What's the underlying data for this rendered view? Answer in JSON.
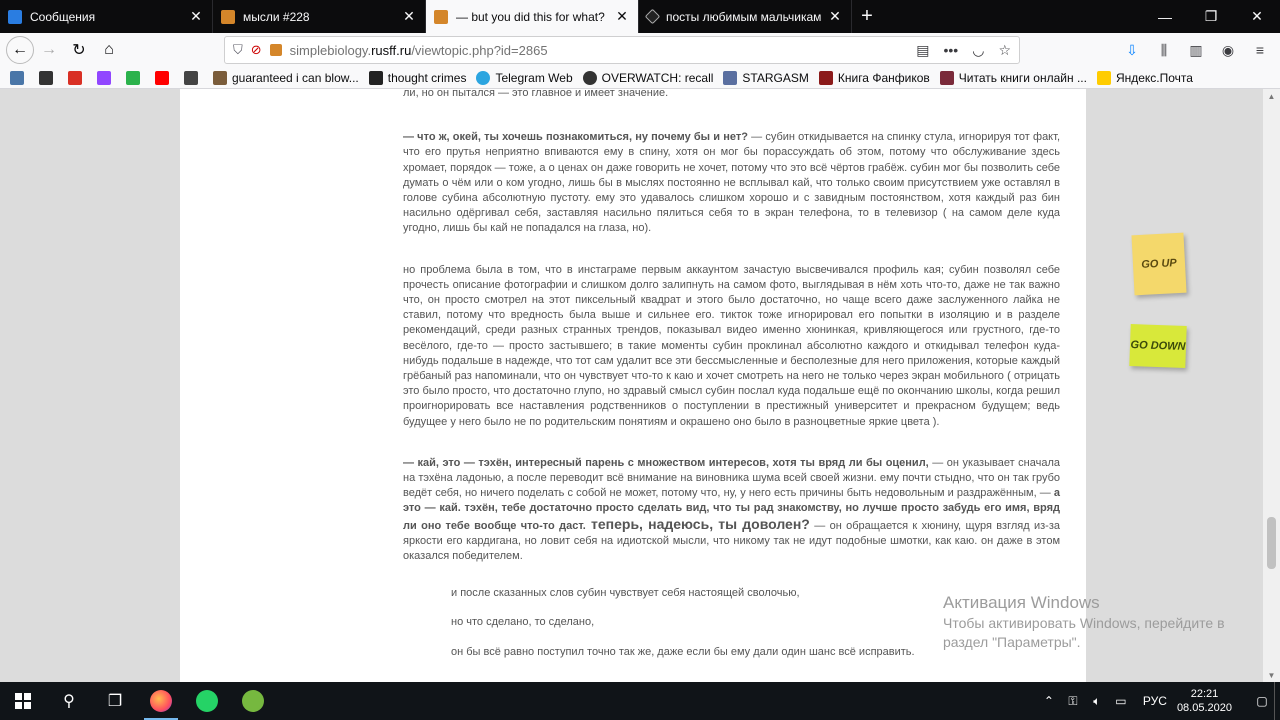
{
  "tabs": [
    {
      "title": "Сообщения",
      "favicon_color": "#2a7de1",
      "active": false
    },
    {
      "title": "мысли #228",
      "favicon_color": "#d4862a",
      "active": false
    },
    {
      "title": "— but you did this for what?",
      "favicon_color": "#d4862a",
      "active": true
    },
    {
      "title": "посты любимым мальчикам",
      "favicon_color": "#222222",
      "active": false
    }
  ],
  "navbar": {
    "url_prefix": "simplebiology.",
    "url_host": "rusff.ru",
    "url_path": "/viewtopic.php?id=2865"
  },
  "bookmarks": [
    {
      "label": "",
      "icon": "vk-icon",
      "color": "#4a76a8"
    },
    {
      "label": "",
      "icon": "bookmark-icon",
      "color": "#333333"
    },
    {
      "label": "",
      "icon": "gmail-icon",
      "color": "#d93025"
    },
    {
      "label": "",
      "icon": "twitch-icon",
      "color": "#9146ff"
    },
    {
      "label": "",
      "icon": "feedly-icon",
      "color": "#2bb24c"
    },
    {
      "label": "",
      "icon": "youtube-icon",
      "color": "#ff0000"
    },
    {
      "label": "",
      "icon": "photoshop-icon",
      "color": "#444444"
    },
    {
      "label": "guaranteed i can blow...",
      "icon": "image-icon",
      "color": "#7a5c3a"
    },
    {
      "label": "thought crimes",
      "icon": "image-icon",
      "color": "#222222"
    },
    {
      "label": "Telegram Web",
      "icon": "telegram-icon",
      "color": "#2ca5e0"
    },
    {
      "label": "OVERWATCH: recall",
      "icon": "overwatch-icon",
      "color": "#333333"
    },
    {
      "label": "STARGASM",
      "icon": "image-icon",
      "color": "#5a6fa0"
    },
    {
      "label": "Книга Фанфиков",
      "icon": "feather-icon",
      "color": "#8b1a1a"
    },
    {
      "label": "Читать книги онлайн ...",
      "icon": "book-icon",
      "color": "#7a2a3a"
    },
    {
      "label": "Яндекс.Почта",
      "icon": "mail-icon",
      "color": "#ffcc00"
    }
  ],
  "post": {
    "top_partial": "ли, но он пытался — это главное и имеет значение.",
    "p1_bold": "— что ж, окей, ты хочешь познакомиться, ну почему бы и нет?",
    "p1_text": " — субин откидывается на спинку стула, игнорируя тот факт, что его прутья неприятно впиваются ему в спину, хотя он мог бы порассуждать об этом, потому что обслуживание здесь хромает, порядок — тоже, а о ценах он даже говорить не хочет, потому что это всё чёртов грабёж. субин мог бы позволить себе думать о чём или о ком угодно, лишь бы в мыслях постоянно не всплывал кай, что только своим присутствием уже оставлял в голове субина абсолютную пустоту. ему это удавалось слишком хорошо и с завидным постоянством, хотя каждый раз бин насильно одёргивал себя, заставляя насильно пялиться себя то в экран телефона, то в телевизор ( на самом деле куда угодно, лишь бы кай не попадался на глаза, но).",
    "p2_text": "но проблема была в том, что в инстаграме первым аккаунтом зачастую высвечивался профиль кая; субин позволял себе прочесть описание фотографии и слишком долго залипнуть на самом фото, выглядывая в нём хоть что-то, даже не так важно что, он просто смотрел на этот пиксельный квадрат и этого было достаточно, но чаще всего даже заслуженного лайка не ставил, потому что вредность была выше и сильнее его. тикток тоже игнорировал его попытки в изоляцию и в разделе рекомендаций, среди разных странных трендов, показывал видео именно хюнинкая, кривляющегося или грустного, где-то весёлого, где-то — просто застывшего; в такие моменты субин проклинал абсолютно каждого и откидывал телефон куда-нибудь подальше в надежде, что тот сам удалит все эти бессмысленные и бесполезные для него приложения, которые каждый грёбаный раз напоминали, что он чувствует что-то к каю и хочет смотреть на него не только через экран мобильного ( отрицать это было просто, что достаточно глупо, но здравый смысл субин послал куда подальше ещё по окончанию школы, когда решил проигнорировать все наставления родственников о поступлении в престижный университет и прекрасном будущем; ведь будущее у него было не по родительским понятиям и окрашено оно было в разноцветные яркие цвета ).",
    "p3_bold1": "— кай, это — тэхён, интересный парень с множеством интересов, хотя ты вряд ли бы оценил,",
    "p3_text1": " — он указывает сначала на тэхёна ладонью, а после переводит всё внимание на виновника шума всей своей жизни. ему почти стыдно, что он так грубо ведёт себя, но ничего поделать с собой не может, потому что, ну, у него есть причины быть недовольным и раздражённым, — ",
    "p3_bold2": "а это — кай. тэхён, тебе достаточно просто сделать вид, что ты рад знакомству, но лучше просто забудь его имя, вряд ли оно тебе вообще что-то даст.",
    "p3_big": " теперь, надеюсь, ты доволен?",
    "p3_text2": " — он обращается к хюнину, щуря взгляд из-за яркости его кардигана, но ловит себя на идиотской мысли, что никому так не идут подобные шмотки, как каю. он даже в этом оказался победителем.",
    "line1": "и после сказанных слов субин чувствует себя настоящей сволочью,",
    "line2": "но что сделано, то сделано,",
    "line3": "он бы всё равно поступил точно так же, даже если бы ему дали один шанс всё исправить."
  },
  "sticky_up": "GO UP",
  "sticky_down": "GO DOWN",
  "activation": {
    "title": "Активация Windows",
    "text": "Чтобы активировать Windows, перейдите в раздел \"Параметры\"."
  },
  "taskbar": {
    "lang": "РУС",
    "time": "22:21",
    "date": "08.05.2020"
  }
}
